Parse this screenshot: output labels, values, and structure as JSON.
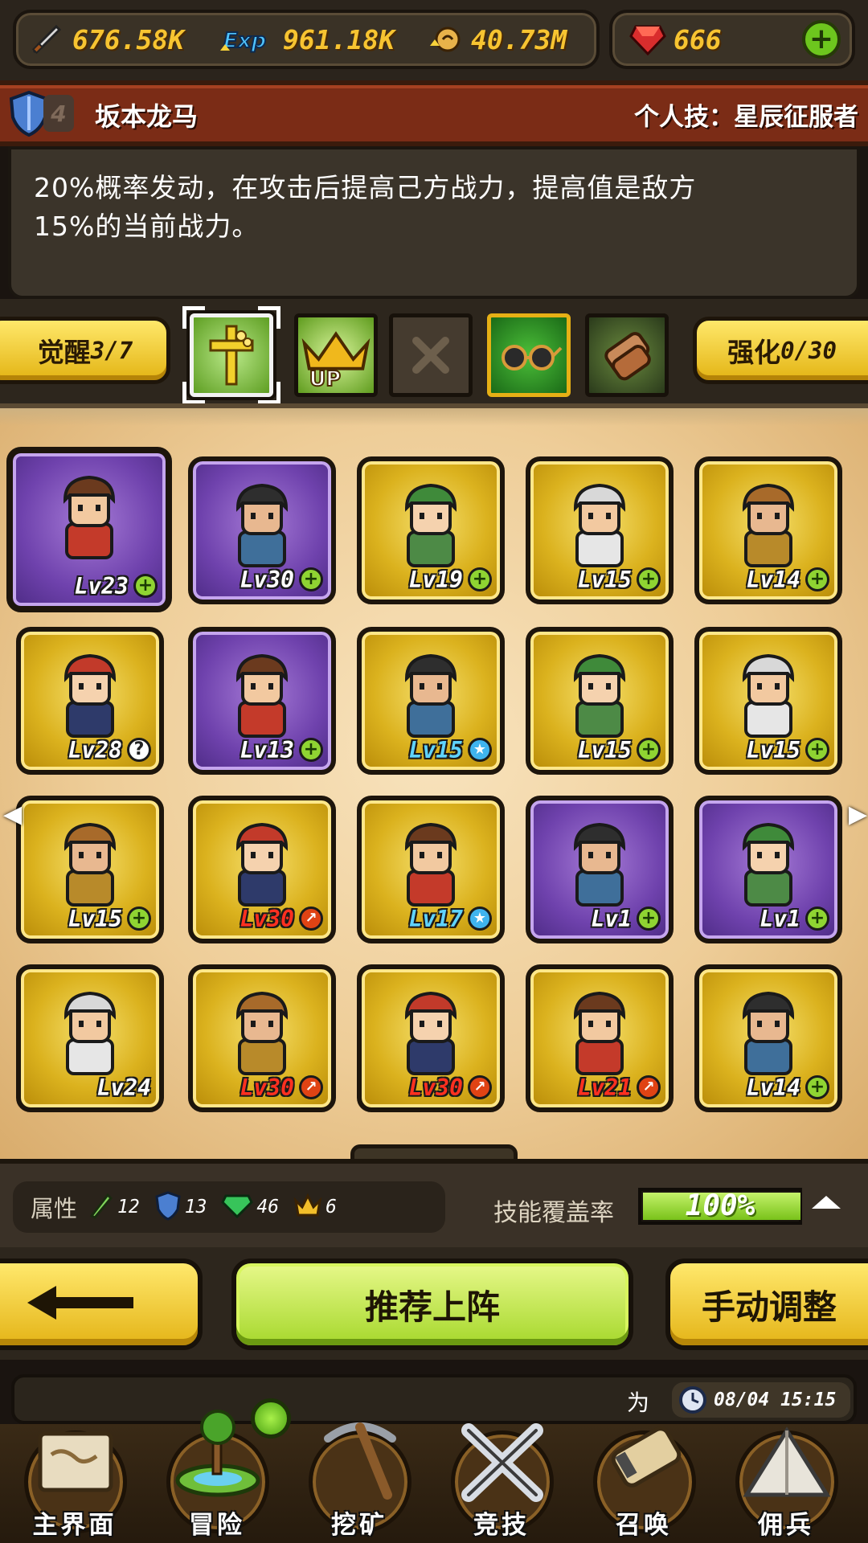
{
  "resources": {
    "attack": "676.58K",
    "exp": "961.18K",
    "gold": "40.73M",
    "gems": "666"
  },
  "hero": {
    "rank": "4",
    "name": "坂本龙马",
    "skill_title": "个人技：星辰征服者",
    "description_line1": "20%概率发动，在攻击后提高己方战力，提高值是敌方",
    "description_line2": "15%的当前战力。"
  },
  "skill_bar": {
    "awaken_label": "觉醒",
    "awaken_value": "3/7",
    "enhance_label": "强化",
    "enhance_value": "0/30"
  },
  "heroes": [
    {
      "level": "Lv23",
      "rarity": "purple",
      "badge": "+",
      "lv_color": "white",
      "selected": true
    },
    {
      "level": "Lv30",
      "rarity": "purple",
      "badge": "+",
      "lv_color": "white"
    },
    {
      "level": "Lv19",
      "rarity": "gold",
      "badge": "+",
      "lv_color": "white"
    },
    {
      "level": "Lv15",
      "rarity": "gold",
      "badge": "+",
      "lv_color": "white"
    },
    {
      "level": "Lv14",
      "rarity": "gold",
      "badge": "+",
      "lv_color": "white"
    },
    {
      "level": "Lv28",
      "rarity": "gold",
      "badge": "?",
      "lv_color": "white"
    },
    {
      "level": "Lv13",
      "rarity": "purple",
      "badge": "+",
      "lv_color": "white"
    },
    {
      "level": "Lv15",
      "rarity": "gold",
      "badge": "★",
      "lv_color": "blue"
    },
    {
      "level": "Lv15",
      "rarity": "gold",
      "badge": "+",
      "lv_color": "white"
    },
    {
      "level": "Lv15",
      "rarity": "gold",
      "badge": "+",
      "lv_color": "white"
    },
    {
      "level": "Lv15",
      "rarity": "gold",
      "badge": "+",
      "lv_color": "white"
    },
    {
      "level": "Lv30",
      "rarity": "gold",
      "badge": "↗",
      "lv_color": "red"
    },
    {
      "level": "Lv17",
      "rarity": "gold",
      "badge": "★",
      "lv_color": "blue"
    },
    {
      "level": "Lv1",
      "rarity": "purple",
      "badge": "+",
      "lv_color": "white"
    },
    {
      "level": "Lv1",
      "rarity": "purple",
      "badge": "+",
      "lv_color": "white"
    },
    {
      "level": "Lv24",
      "rarity": "gold",
      "badge": "",
      "lv_color": "white"
    },
    {
      "level": "Lv30",
      "rarity": "gold",
      "badge": "↗",
      "lv_color": "red"
    },
    {
      "level": "Lv30",
      "rarity": "gold",
      "badge": "↗",
      "lv_color": "red"
    },
    {
      "level": "Lv21",
      "rarity": "gold",
      "badge": "↗",
      "lv_color": "red"
    },
    {
      "level": "Lv14",
      "rarity": "gold",
      "badge": "+",
      "lv_color": "white"
    }
  ],
  "pagination": {
    "pages": 5,
    "active": 2
  },
  "attributes": {
    "label": "属性",
    "sword": "12",
    "shield": "13",
    "gem": "46",
    "crown": "6"
  },
  "coverage": {
    "label": "技能覆盖率",
    "value_text": "100%",
    "fraction": 1.0
  },
  "actions": {
    "recommend": "推荐上阵",
    "manual": "手动调整"
  },
  "message": {
    "text": "为",
    "time": "08/04 15:15"
  },
  "nav": [
    {
      "label": "主界面"
    },
    {
      "label": "冒险"
    },
    {
      "label": "挖矿"
    },
    {
      "label": "竞技"
    },
    {
      "label": "召唤"
    },
    {
      "label": "佣兵"
    }
  ],
  "colors": {
    "gold_card": "#dbb21e",
    "purple_card": "#6f42ad",
    "accent_green": "#a6d82c",
    "header_red": "#7b2c16"
  }
}
